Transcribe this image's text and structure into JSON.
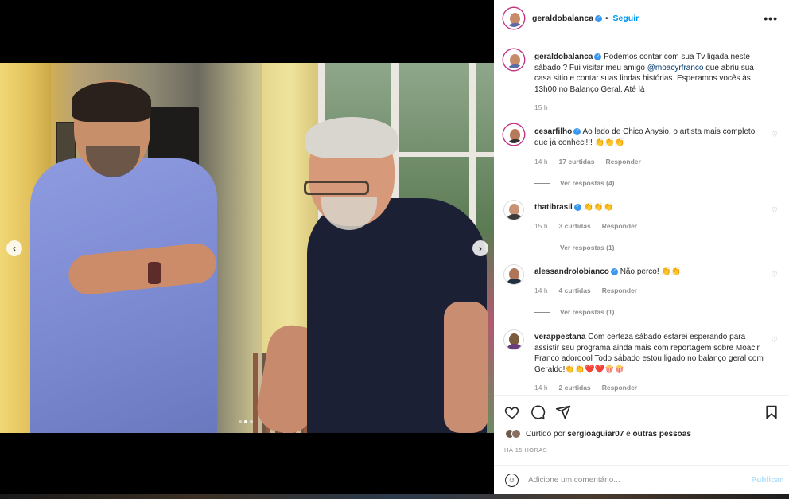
{
  "post": {
    "username": "geraldobalanca",
    "follow_label": "Seguir",
    "more_label": "•••",
    "caption_rest_1": " Podemos contar com sua Tv ligada neste sábado ? Fui visitar meu amigo ",
    "caption_mention": "@moacyrfranco",
    "caption_rest_2": " que abriu sua casa sitio e contar suas lindas histórias. Esperamos vocês às 13h00 no Balanço Geral. Até lá",
    "caption_time": "15 h"
  },
  "comments": [
    {
      "user": "cesarfilho",
      "text": " Ao lado de Chico Anysio, o artista mais completo que já conheci!!! 👏👏👏",
      "time": "14 h",
      "likes": "17 curtidas",
      "reply": "Responder",
      "replies": "Ver respostas (4)"
    },
    {
      "user": "thatibrasil",
      "text": " 👏👏👏",
      "time": "15 h",
      "likes": "3 curtidas",
      "reply": "Responder",
      "replies": "Ver respostas (1)"
    },
    {
      "user": "alessandrolobianco",
      "text": " Não perco! 👏👏",
      "time": "14 h",
      "likes": "4 curtidas",
      "reply": "Responder",
      "replies": "Ver respostas (1)"
    },
    {
      "user": "verappestana",
      "text": " Com certeza sábado estarei esperando para assistir seu programa ainda mais com reportagem sobre Moacir Franco adoroool Todo sábado estou ligado no balanço geral com Geraldo!👏👏❤️❤️🍿🍿",
      "time": "14 h",
      "likes": "2 curtidas",
      "reply": "Responder"
    }
  ],
  "likes": {
    "prefix": "Curtido por ",
    "user": "sergioaguiar07",
    "middle": " e ",
    "others": "outras pessoas"
  },
  "timestamp": "HÁ 15 HORAS",
  "composer": {
    "placeholder": "Adicione um comentário...",
    "publish_label": "Publicar"
  },
  "carousel": {
    "count": 3,
    "active": 2
  },
  "colors": {
    "accent": "#0095f6",
    "verified": "#3897f0",
    "publish_disabled": "#b2dffc"
  },
  "icons": [
    "heart-icon",
    "comment-icon",
    "share-icon",
    "bookmark-icon",
    "emoji-icon",
    "verified-icon",
    "more-options-icon",
    "chevron-left-icon",
    "chevron-right-icon"
  ]
}
